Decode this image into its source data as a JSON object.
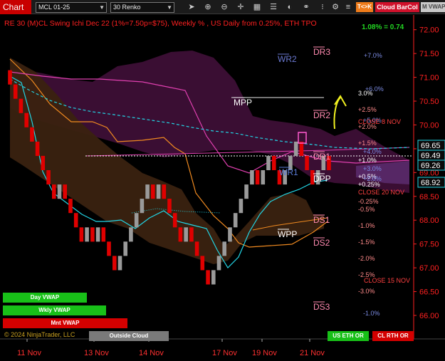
{
  "toolbar": {
    "app_label": "Chart",
    "symbol": "MCL 01-25",
    "bar_type": "30 Renko",
    "indicator_button": "T<>K",
    "cloud_button": "Cloud BarCol",
    "vwap_button": "M VWAP"
  },
  "icons": [
    "cursor-icon",
    "zoom-in-icon",
    "zoom-out-icon",
    "crosshair-icon",
    "tile-icon",
    "menu-icon",
    "color-icon",
    "link-icon",
    "grid-icon",
    "gear-icon",
    "list-icon"
  ],
  "colors": {
    "background": "#000000",
    "up_bar": "#9a9a9a",
    "down_bar": "#e00000",
    "cloud_purple": "#3d0f36",
    "cloud_brown": "#3a2210",
    "price_axis": "#ff2020",
    "cyan": "#22d6e6"
  },
  "chart_data": {
    "type": "candlestick",
    "title": "RE 30 (M)CL Swing Ichi Dec 22  (1%=7.50p=$75), Weekly % , US Daily from 0.25%, ETH TPO",
    "top_readout": "1.08% = 0.74",
    "yaxis": {
      "ticks": [
        "72.00",
        "71.50",
        "71.00",
        "70.50",
        "70.00",
        "69.50",
        "69.00",
        "68.50",
        "68.00",
        "67.50",
        "67.00",
        "66.50",
        "66.00"
      ],
      "ylim": [
        65.85,
        72.25
      ]
    },
    "xaxis": {
      "labels": [
        "11 Nov",
        "13 Nov",
        "14 Nov",
        "17 Nov",
        "19 Nov",
        "21 Nov"
      ]
    },
    "price_labels": [
      {
        "text": "69.65",
        "value": 69.65
      },
      {
        "text": "69.49",
        "value": 69.49
      },
      {
        "text": "69.26",
        "value": 69.26
      },
      {
        "text": "68.92",
        "value": 68.92
      }
    ],
    "level_labels": [
      "DR3",
      "WR2",
      "MPP",
      "DR2",
      "DR1",
      "WR1",
      "DPP",
      "DS1",
      "WPP",
      "DS2",
      "DS3"
    ],
    "percent_labels": [
      "+7.0%",
      "+6.0%",
      "3.0%",
      "+2.5%",
      "+2.0%",
      "+5.0%",
      "+1.5%",
      "+4.0%",
      "+1.0%",
      "+3.0%",
      "+0.5%",
      "+2.0%",
      "+0.25%",
      "-0.25%",
      "-0.5%",
      "-1.0%",
      "-1.5%",
      "-2.0%",
      "-2.5%",
      "-3.0%",
      "-1.0%"
    ],
    "close_labels": [
      "CLOSE 8 NOV",
      "CLOSE 20 NOV",
      "CLOSE 15 NOV"
    ],
    "bars": [
      {
        "o": 71.15,
        "c": 70.85
      },
      {
        "o": 70.85,
        "c": 70.55
      },
      {
        "o": 70.55,
        "c": 70.25
      },
      {
        "o": 70.25,
        "c": 69.95
      },
      {
        "o": 69.95,
        "c": 69.65
      },
      {
        "o": 69.65,
        "c": 69.35
      },
      {
        "o": 69.35,
        "c": 69.05
      },
      {
        "o": 69.05,
        "c": 68.75
      },
      {
        "o": 68.75,
        "c": 68.45
      },
      {
        "o": 68.45,
        "c": 68.75
      },
      {
        "o": 68.75,
        "c": 68.45
      },
      {
        "o": 68.45,
        "c": 68.15
      },
      {
        "o": 68.15,
        "c": 67.85
      },
      {
        "o": 67.85,
        "c": 67.55
      },
      {
        "o": 67.55,
        "c": 67.85
      },
      {
        "o": 67.85,
        "c": 67.55
      },
      {
        "o": 67.55,
        "c": 67.85
      },
      {
        "o": 67.85,
        "c": 67.55
      },
      {
        "o": 67.55,
        "c": 67.25
      },
      {
        "o": 67.25,
        "c": 66.95
      },
      {
        "o": 66.95,
        "c": 67.25
      },
      {
        "o": 67.25,
        "c": 67.55
      },
      {
        "o": 67.55,
        "c": 67.85
      },
      {
        "o": 67.85,
        "c": 68.15
      },
      {
        "o": 68.15,
        "c": 68.45
      },
      {
        "o": 68.45,
        "c": 68.75
      },
      {
        "o": 68.75,
        "c": 68.45
      },
      {
        "o": 68.45,
        "c": 68.75
      },
      {
        "o": 68.75,
        "c": 68.45
      },
      {
        "o": 68.45,
        "c": 68.15
      },
      {
        "o": 68.15,
        "c": 67.85
      },
      {
        "o": 67.85,
        "c": 67.55
      },
      {
        "o": 67.55,
        "c": 67.85
      },
      {
        "o": 67.85,
        "c": 67.55
      },
      {
        "o": 67.55,
        "c": 67.25
      },
      {
        "o": 67.25,
        "c": 66.95
      },
      {
        "o": 66.95,
        "c": 66.65
      },
      {
        "o": 66.65,
        "c": 66.95
      },
      {
        "o": 66.95,
        "c": 67.25
      },
      {
        "o": 67.25,
        "c": 67.55
      },
      {
        "o": 67.55,
        "c": 67.85
      },
      {
        "o": 67.85,
        "c": 68.15
      },
      {
        "o": 68.15,
        "c": 68.45
      },
      {
        "o": 68.45,
        "c": 68.75
      },
      {
        "o": 68.75,
        "c": 69.05
      },
      {
        "o": 69.05,
        "c": 68.75
      },
      {
        "o": 68.75,
        "c": 69.05
      },
      {
        "o": 69.05,
        "c": 69.35
      },
      {
        "o": 69.35,
        "c": 69.05
      },
      {
        "o": 69.05,
        "c": 68.75
      },
      {
        "o": 68.75,
        "c": 69.05
      },
      {
        "o": 69.05,
        "c": 69.35
      },
      {
        "o": 69.35,
        "c": 69.65
      },
      {
        "o": 69.65,
        "c": 69.35
      },
      {
        "o": 69.35,
        "c": 69.05
      },
      {
        "o": 69.05,
        "c": 68.75
      },
      {
        "o": 68.75,
        "c": 69.05
      },
      {
        "o": 69.05,
        "c": 69.35
      },
      {
        "o": 69.35,
        "c": 69.05
      }
    ]
  },
  "legend_buttons": [
    {
      "label": "Day VWAP",
      "color": "#18c018"
    },
    {
      "label": "Wkly VWAP",
      "color": "#18c018"
    },
    {
      "label": "Mnt VWAP",
      "color": "#d40000"
    }
  ],
  "copyright": "© 2024 NinjaTrader, LLC",
  "outside_cloud": "Outside Cloud",
  "session_buttons": [
    {
      "label": "US ETH OR",
      "color": "#18c018"
    },
    {
      "label": "CL RTH OR",
      "color": "#d40000"
    }
  ]
}
